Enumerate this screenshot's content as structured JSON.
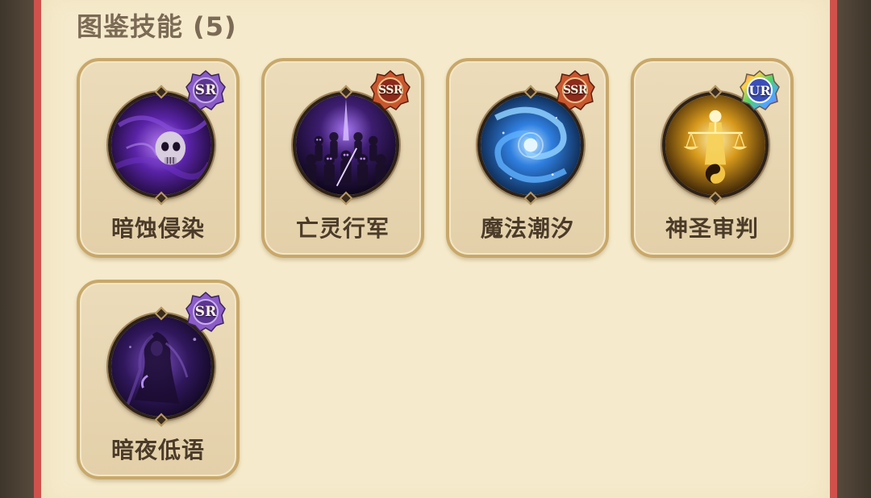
{
  "section": {
    "title": "图鉴技能 (5)"
  },
  "colors": {
    "panel_bg": "#f5eacb",
    "panel_border": "#d0514c",
    "card_border": "#c8a86a",
    "title_text": "#7b6a55",
    "name_text": "#4b3b29"
  },
  "skills": [
    {
      "name": "暗蚀侵染",
      "rarity": "SR",
      "icon": "shadow-skull-icon"
    },
    {
      "name": "亡灵行军",
      "rarity": "SSR",
      "icon": "undead-army-icon"
    },
    {
      "name": "魔法潮汐",
      "rarity": "SSR",
      "icon": "magic-tide-icon"
    },
    {
      "name": "神圣审判",
      "rarity": "UR",
      "icon": "holy-judgment-icon"
    },
    {
      "name": "暗夜低语",
      "rarity": "SR",
      "icon": "night-whisper-icon"
    }
  ]
}
